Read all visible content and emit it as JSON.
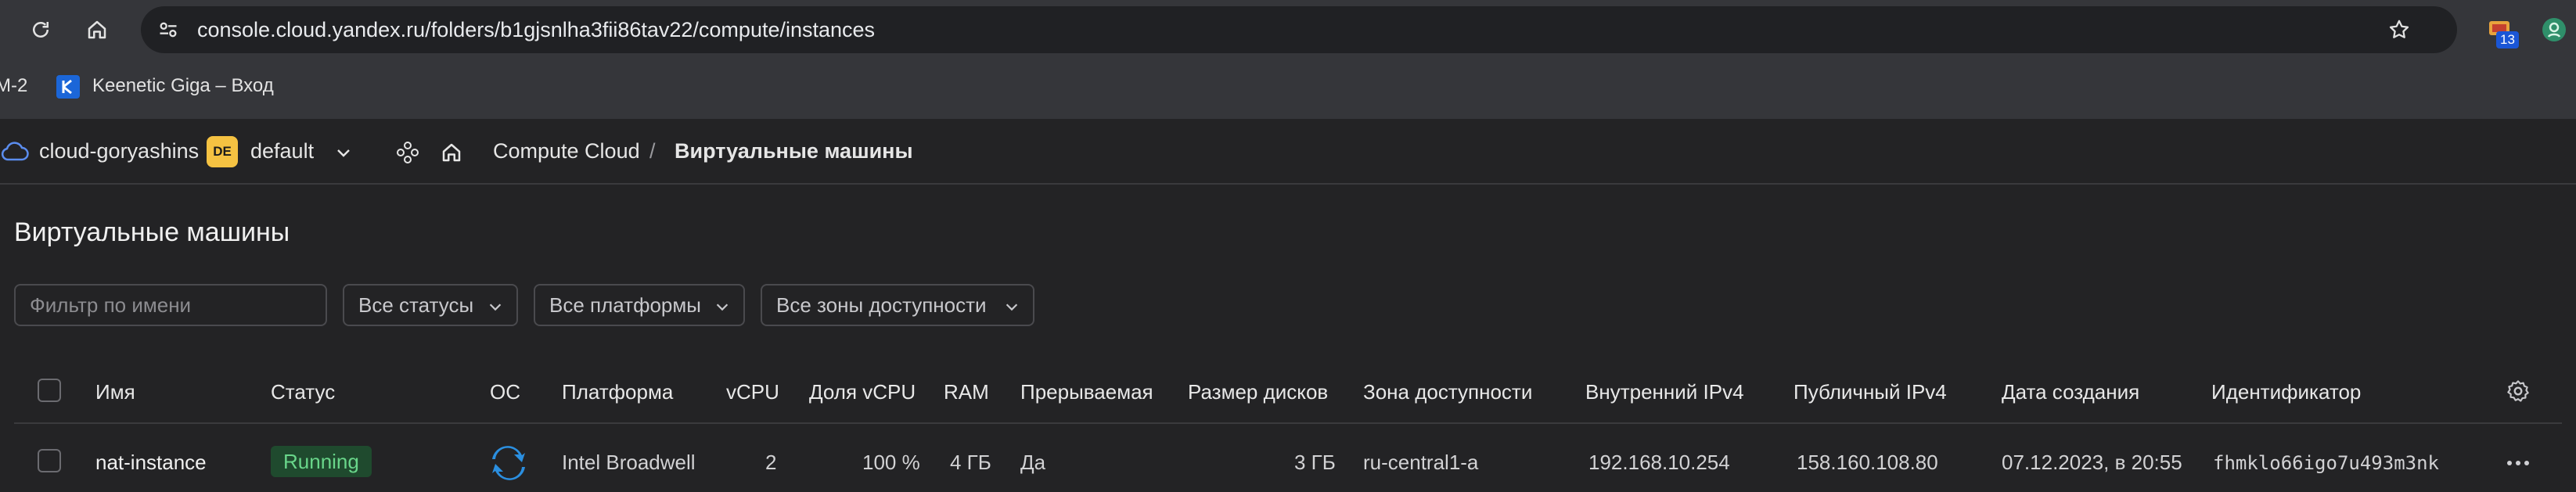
{
  "browser": {
    "url": "console.cloud.yandex.ru/folders/b1gjsnlha3fii86tav22/compute/instances",
    "extension_badge": "13",
    "bookmarks": [
      "М-2",
      "Keenetic Giga – Вход"
    ]
  },
  "header": {
    "cloud_name": "cloud-goryashins",
    "folder_badge": "DE",
    "folder_name": "default",
    "breadcrumb": [
      "Compute Cloud",
      "Виртуальные машины"
    ],
    "breadcrumb_separator": "/"
  },
  "page": {
    "title": "Виртуальные машины"
  },
  "filters": {
    "name_placeholder": "Фильтр по имени",
    "status": "Все статусы",
    "platform": "Все платформы",
    "zone": "Все зоны доступности"
  },
  "table": {
    "columns": [
      "Имя",
      "Статус",
      "ОС",
      "Платформа",
      "vCPU",
      "Доля vCPU",
      "RAM",
      "Прерываемая",
      "Размер дисков",
      "Зона доступности",
      "Внутренний IPv4",
      "Публичный IPv4",
      "Дата создания",
      "Идентификатор"
    ],
    "rows": [
      {
        "name": "nat-instance",
        "status": "Running",
        "os_icon": "os-logo-icon",
        "platform": "Intel Broadwell",
        "vcpu": "2",
        "vcpu_share": "100 %",
        "ram": "4 ГБ",
        "preemptible": "Да",
        "disk_size": "3 ГБ",
        "zone": "ru-central1-a",
        "internal_ipv4": "192.168.10.254",
        "public_ipv4": "158.160.108.80",
        "created": "07.12.2023, в 20:55",
        "id": "fhmklo66igo7u493m3nk"
      }
    ]
  },
  "colors": {
    "background": "#232325",
    "running_badge_bg": "#1f4a2e",
    "running_badge_text": "#69d68a",
    "folder_badge": "#f5c242",
    "cloud_icon": "#5b8def"
  }
}
